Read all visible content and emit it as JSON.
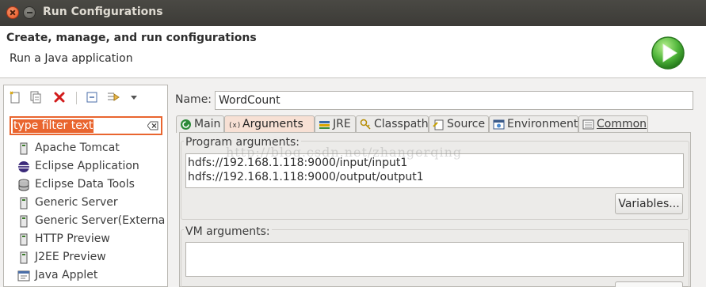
{
  "window": {
    "title": "Run Configurations",
    "close_icon": "close-icon",
    "minimize_icon": "minimize-icon"
  },
  "banner": {
    "heading": "Create, manage, and run configurations",
    "subtitle": "Run a Java application",
    "icon": "run-play-icon"
  },
  "toolbar": {
    "icons": [
      "new-configuration-icon",
      "duplicate-icon",
      "delete-icon",
      "collapse-all-icon",
      "filter-icon",
      "chevron-down-icon"
    ]
  },
  "filter": {
    "placeholder": "type filter text",
    "clear_icon": "clear-icon"
  },
  "tree": {
    "items": [
      {
        "label": "Apache Tomcat",
        "icon": "server-icon"
      },
      {
        "label": "Eclipse Application",
        "icon": "eclipse-icon"
      },
      {
        "label": "Eclipse Data Tools",
        "icon": "database-icon"
      },
      {
        "label": "Generic Server",
        "icon": "server-icon"
      },
      {
        "label": "Generic Server(External",
        "icon": "server-icon"
      },
      {
        "label": "HTTP Preview",
        "icon": "server-icon"
      },
      {
        "label": "J2EE Preview",
        "icon": "server-icon"
      },
      {
        "label": "Java Applet",
        "icon": "applet-icon"
      }
    ]
  },
  "name": {
    "label": "Name:",
    "value": "WordCount"
  },
  "tabs": [
    {
      "label": "Main",
      "icon": "main-tab-icon"
    },
    {
      "label": "Arguments",
      "icon": "arguments-icon"
    },
    {
      "label": "JRE",
      "icon": "jre-icon"
    },
    {
      "label": "Classpath",
      "icon": "classpath-icon"
    },
    {
      "label": "Source",
      "icon": "source-icon"
    },
    {
      "label": "Environment",
      "icon": "environment-icon"
    },
    {
      "label": "Common",
      "icon": "common-icon"
    }
  ],
  "arguments": {
    "program_label": "Program arguments:",
    "program_lines": [
      "hdfs://192.168.1.118:9000/input/input1",
      "hdfs://192.168.1.118:9000/output/output1"
    ],
    "variables_button": "Variables...",
    "vm_label": "VM arguments:"
  },
  "watermark": "http://blog.csdn.net/zhangerqing",
  "colors": {
    "accent": "#e9652f",
    "active_tab": "#f7e0d4",
    "titlebar": "#3c3b37"
  }
}
